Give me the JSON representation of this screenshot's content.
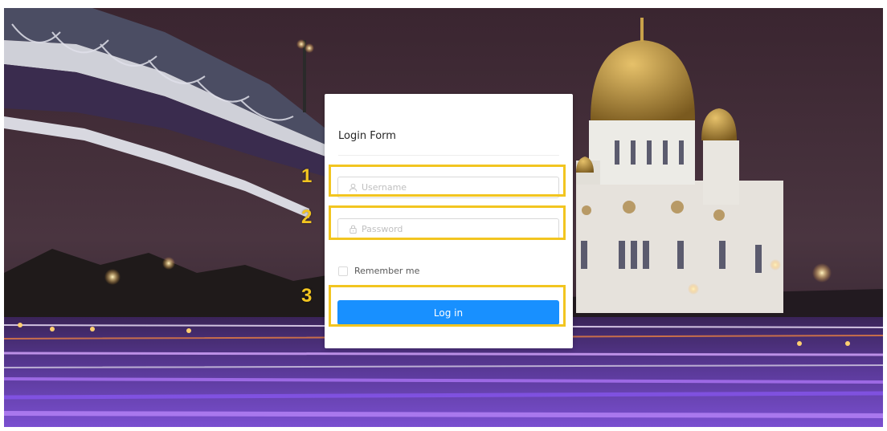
{
  "form": {
    "title": "Login Form",
    "username_placeholder": "Username",
    "password_placeholder": "Password",
    "remember_label": "Remember me",
    "submit_label": "Log in",
    "accent_color": "#1890ff"
  },
  "annotations": {
    "color": "#f2c520",
    "step1": "1",
    "step2": "2",
    "step3": "3"
  },
  "icons": {
    "username": "user-icon",
    "password": "lock-icon"
  }
}
